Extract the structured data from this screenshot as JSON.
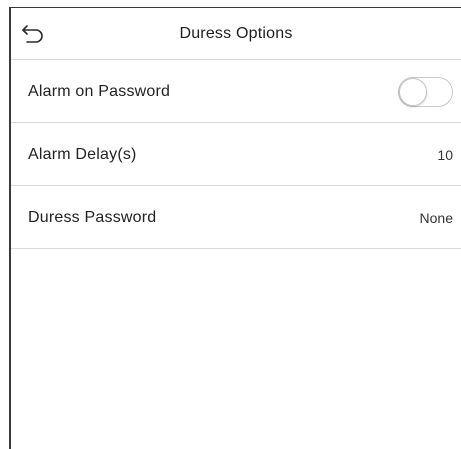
{
  "header": {
    "title": "Duress Options",
    "back_icon": "back-arrow-icon"
  },
  "rows": [
    {
      "label": "Alarm on Password",
      "type": "toggle",
      "toggle_on": false
    },
    {
      "label": "Alarm Delay(s)",
      "type": "value",
      "value": "10"
    },
    {
      "label": "Duress Password",
      "type": "value",
      "value": "None"
    }
  ],
  "colors": {
    "background": "#ffffff",
    "divider": "#d9d9d9",
    "text": "#222222",
    "toggle_border": "#c8c8c8"
  }
}
